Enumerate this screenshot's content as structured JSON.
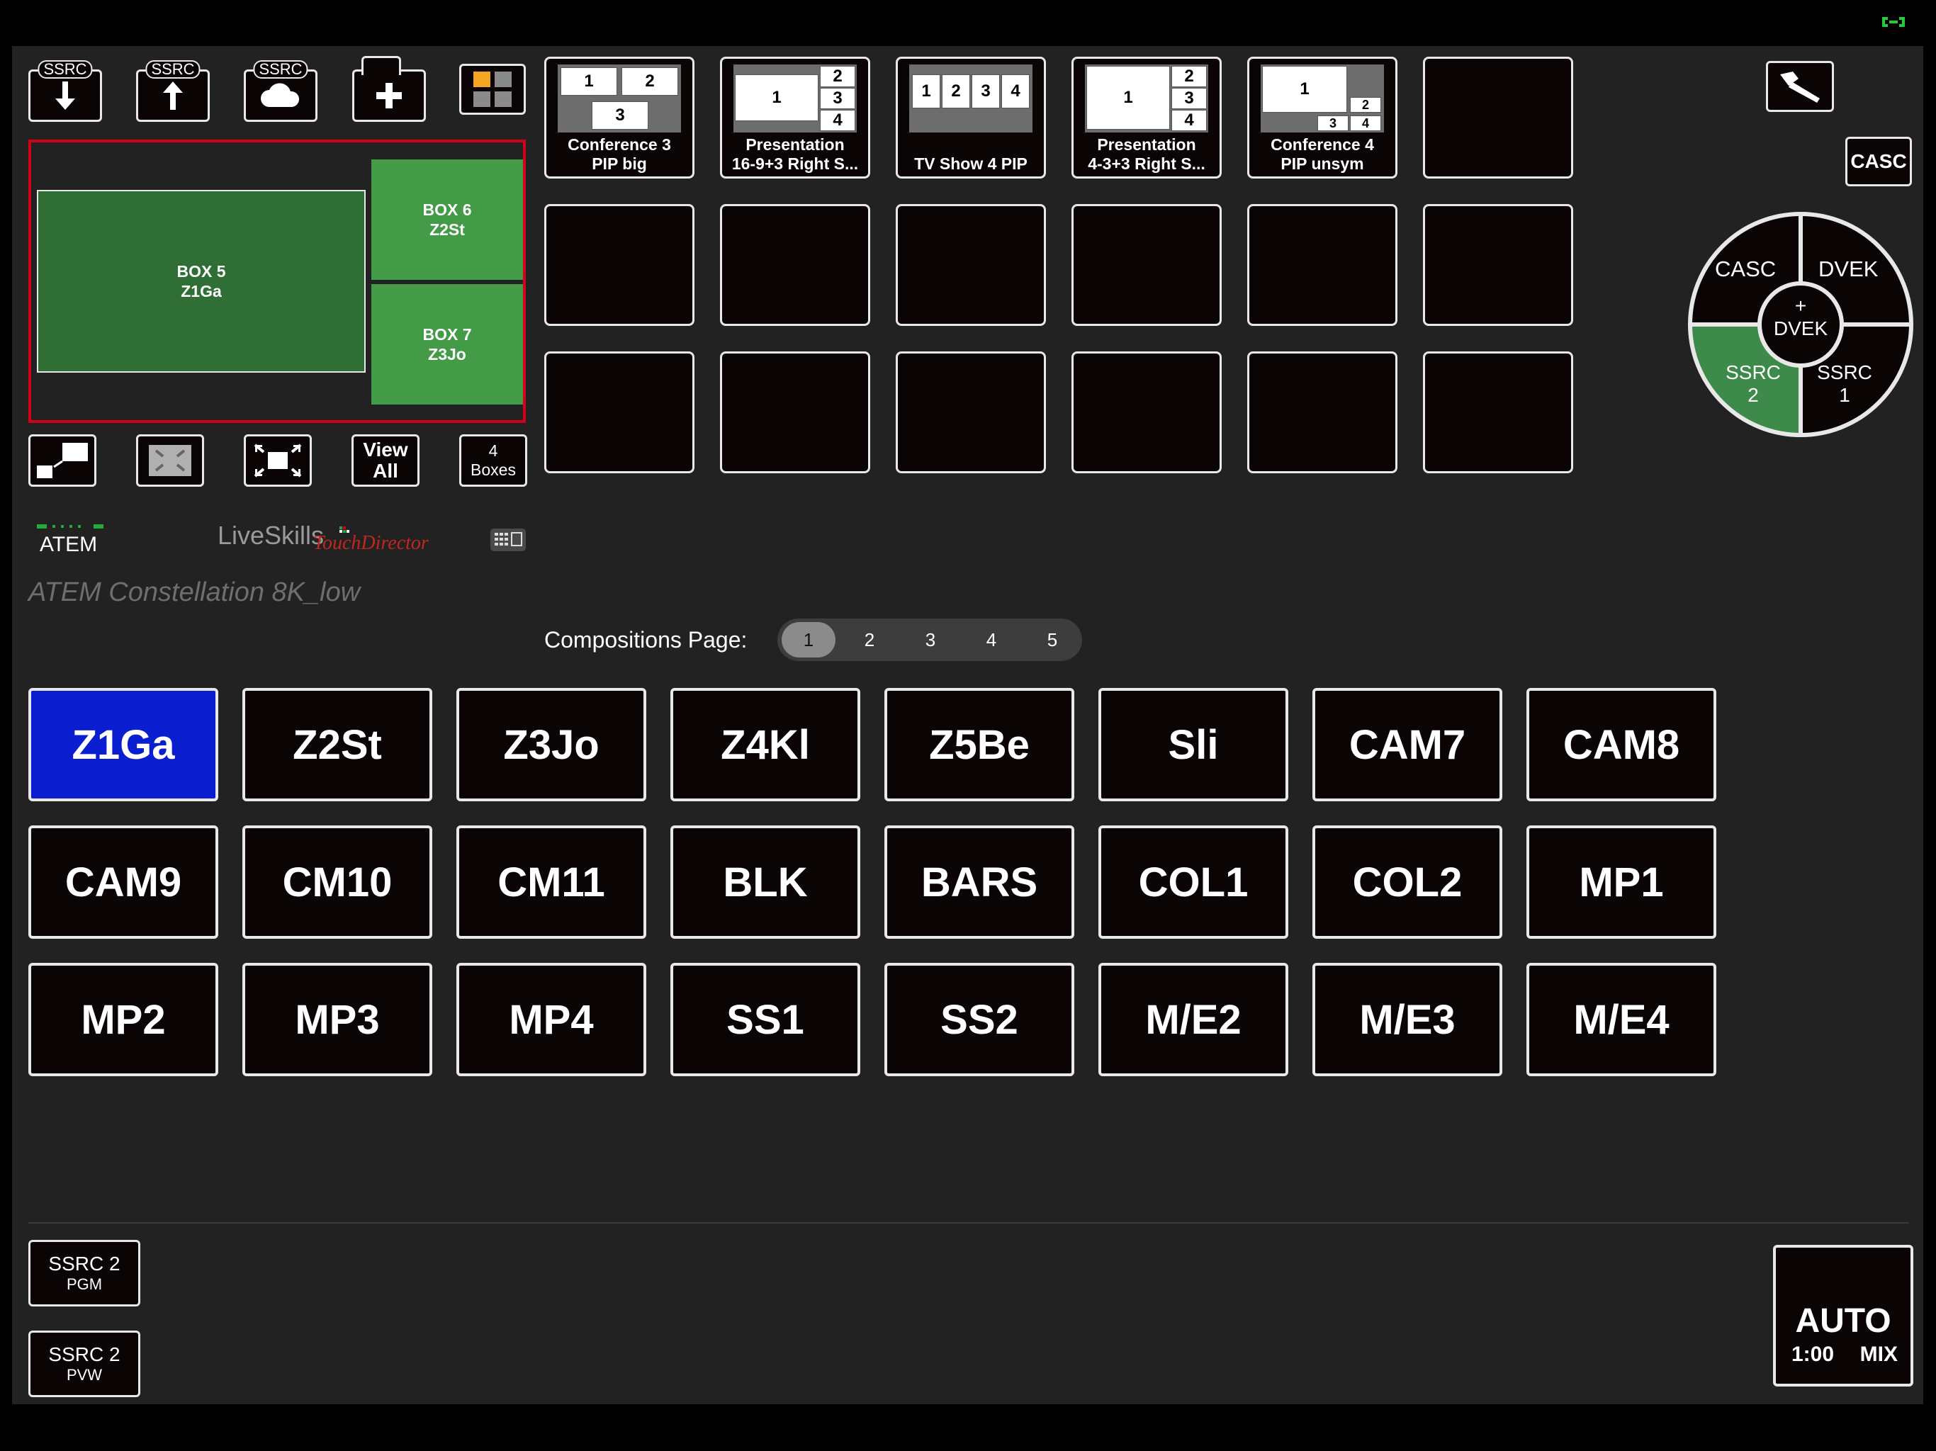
{
  "status_icon": "link-icon",
  "toolbar": {
    "ssrc_tag": "SSRC",
    "buttons": [
      "download-icon",
      "upload-icon",
      "cloud-icon",
      "add-folder-icon",
      "grid-color-icon"
    ]
  },
  "preview": {
    "box5": {
      "line1": "BOX 5",
      "line2": "Z1Ga"
    },
    "box6": {
      "line1": "BOX 6",
      "line2": "Z2St"
    },
    "box7": {
      "line1": "BOX 7",
      "line2": "Z3Jo"
    }
  },
  "bottom_tools": {
    "view_all": {
      "line1": "View",
      "line2": "All"
    },
    "boxes": {
      "line1": "4",
      "line2": "Boxes"
    }
  },
  "brand": {
    "atem_label": "ATEM",
    "liveskills": "LiveSkills",
    "touchdirector": "TouchDirector",
    "device_name": "ATEM Constellation 8K_low"
  },
  "compositions": {
    "tiles": [
      {
        "line1": "Conference 3",
        "line2": "PIP big",
        "cells": [
          "1",
          "2",
          "3"
        ]
      },
      {
        "line1": "Presentation",
        "line2": "16-9+3 Right S...",
        "cells": [
          "1",
          "2",
          "3",
          "4"
        ]
      },
      {
        "line1": "TV Show 4 PIP",
        "line2": "",
        "cells": [
          "1",
          "2",
          "3",
          "4"
        ]
      },
      {
        "line1": "Presentation",
        "line2": "4-3+3 Right S...",
        "cells": [
          "1",
          "2",
          "3",
          "4"
        ]
      },
      {
        "line1": "Conference 4",
        "line2": "PIP unsym",
        "cells": [
          "1",
          "2",
          "3",
          "4"
        ]
      }
    ]
  },
  "right_panel": {
    "casc_button": "CASC",
    "wheel": {
      "top_left": "CASC",
      "top_right": "DVEK",
      "center_line1": "+",
      "center_line2": "DVEK",
      "bottom_left_line1": "SSRC",
      "bottom_left_line2": "2",
      "bottom_right_line1": "SSRC",
      "bottom_right_line2": "1"
    },
    "accent_green": "#3d8a4a"
  },
  "pager": {
    "label": "Compositions Page:",
    "pages": [
      "1",
      "2",
      "3",
      "4",
      "5"
    ],
    "active": "1"
  },
  "sources": {
    "row1": [
      "Z1Ga",
      "Z2St",
      "Z3Jo",
      "Z4Kl",
      "Z5Be",
      "Sli",
      "CAM7",
      "CAM8"
    ],
    "row2": [
      "CAM9",
      "CM10",
      "CM11",
      "BLK",
      "BARS",
      "COL1",
      "COL2",
      "MP1"
    ],
    "row3": [
      "MP2",
      "MP3",
      "MP4",
      "SS1",
      "SS2",
      "M/E2",
      "M/E3",
      "M/E4"
    ],
    "active": "Z1Ga",
    "active_color": "#0a1ed0"
  },
  "footer": {
    "pgm": {
      "line1": "SSRC 2",
      "line2": "PGM"
    },
    "pvw": {
      "line1": "SSRC 2",
      "line2": "PVW"
    },
    "auto": {
      "title": "AUTO",
      "time": "1:00",
      "mode": "MIX"
    }
  }
}
